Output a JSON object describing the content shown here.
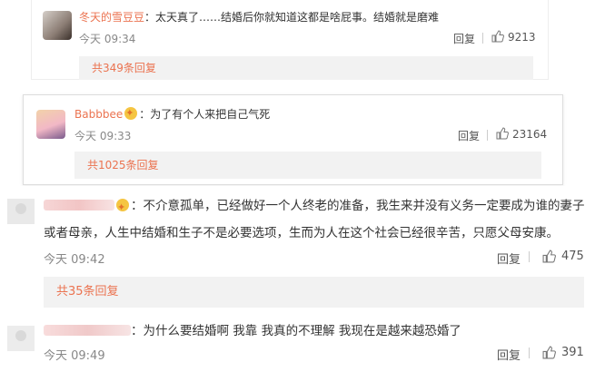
{
  "comments": [
    {
      "username": "冬天的雪豆豆",
      "text": "：太天真了……结婚后你就知道这都是啥屁事。结婚就是磨难",
      "time": "今天 09:34",
      "reply_label": "回复",
      "likes": "9213",
      "subreplies": "共349条回复"
    },
    {
      "username": "Babbbee",
      "text": "：为了有个人来把自己气死",
      "time": "今天 09:33",
      "reply_label": "回复",
      "likes": "23164",
      "subreplies": "共1025条回复"
    },
    {
      "text_line1": "：不介意孤单，已经做好一个人终老的准备，我生来并没有义务一定要成为谁的妻子",
      "text_line2": "或者母亲，人生中结婚和生子不是必要选项，生而为人在这个社会已经很辛苦，只愿父母安康。",
      "time": "今天 09:42",
      "reply_label": "回复",
      "likes": "475",
      "subreplies": "共35条回复"
    },
    {
      "text": "：为什么要结婚啊 我靠 我真的不理解 我现在是越来越恐婚了",
      "time": "今天 09:49",
      "reply_label": "回复",
      "likes": "391"
    }
  ],
  "icons": {
    "like": "thumbs-up-icon",
    "badge": "member-badge-icon"
  },
  "colors": {
    "username": "#eb7350",
    "subreply_link": "#eb7350",
    "subreply_bg": "#f2f2f2"
  }
}
